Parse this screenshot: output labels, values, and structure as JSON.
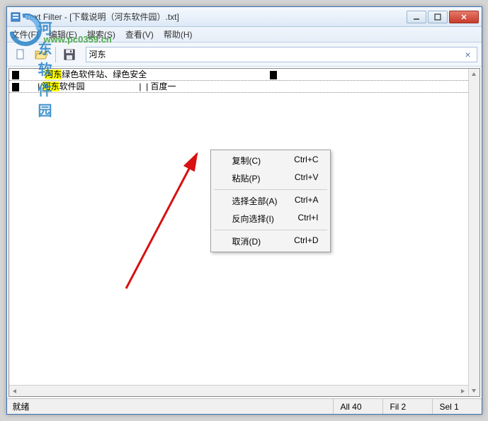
{
  "window": {
    "title": "Text Filter - [下载说明（河东软件园）.txt]"
  },
  "menubar": {
    "file": "文件(F)",
    "edit": "编辑(E)",
    "search": "搜索(S)",
    "view": "查看(V)",
    "help": "帮助(H)"
  },
  "toolbar": {
    "new_icon": "new-file-icon",
    "open_icon": "open-folder-icon",
    "save_icon": "save-icon"
  },
  "search": {
    "value": "河东",
    "clear_symbol": "×"
  },
  "content": {
    "lines": [
      {
        "prefix_block": true,
        "pre": "           ",
        "hl": "河东",
        "post": "绿色软件站、绿色安全",
        "trail_block": true
      },
      {
        "prefix_block": true,
        "pre": "        | ",
        "hl": "河东",
        "post": "软件园                       |  | 百度一",
        "trail_dotted": true
      }
    ]
  },
  "context_menu": {
    "copy": {
      "label": "复制(C)",
      "shortcut": "Ctrl+C"
    },
    "paste": {
      "label": "粘贴(P)",
      "shortcut": "Ctrl+V"
    },
    "select_all": {
      "label": "选择全部(A)",
      "shortcut": "Ctrl+A"
    },
    "invert_select": {
      "label": "反向选择(I)",
      "shortcut": "Ctrl+I"
    },
    "cancel": {
      "label": "取消(D)",
      "shortcut": "Ctrl+D"
    }
  },
  "statusbar": {
    "left": "就绪",
    "all": "All  40",
    "fil": "Fil  2",
    "sel": "Sel  1"
  },
  "watermark": {
    "line1": "河东软件园",
    "line2": "www.pc0359.cn"
  }
}
